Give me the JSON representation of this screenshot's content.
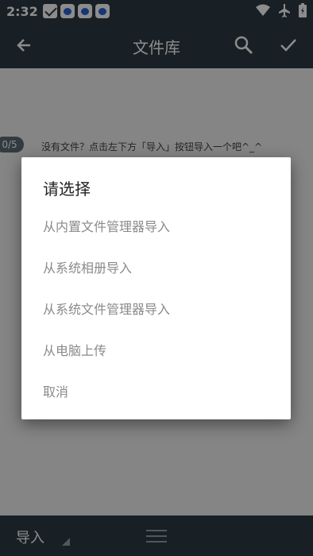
{
  "status_bar": {
    "time": "2:32",
    "notification_icons": [
      "mail-icon",
      "baidu-icon",
      "baidu-icon",
      "baidu-icon"
    ],
    "right_icons": [
      "wifi-icon",
      "airplane-icon",
      "battery-icon"
    ]
  },
  "app_bar": {
    "title": "文件库",
    "back_icon": "arrow-left-icon",
    "search_icon": "search-icon",
    "confirm_icon": "check-icon"
  },
  "content": {
    "counter": "0/5",
    "hint": "没有文件？点击左下方「导入」按钮导入一个吧^_^"
  },
  "bottom_bar": {
    "import_label": "导入",
    "menu_icon": "menu-icon"
  },
  "dialog": {
    "title": "请选择",
    "options": [
      "从内置文件管理器导入",
      "从系统相册导入",
      "从系统文件管理器导入",
      "从电脑上传",
      "取消"
    ]
  },
  "colors": {
    "bar": "#2c3b44",
    "option_text": "#8a8a8a",
    "dialog_bg": "#ffffff"
  }
}
